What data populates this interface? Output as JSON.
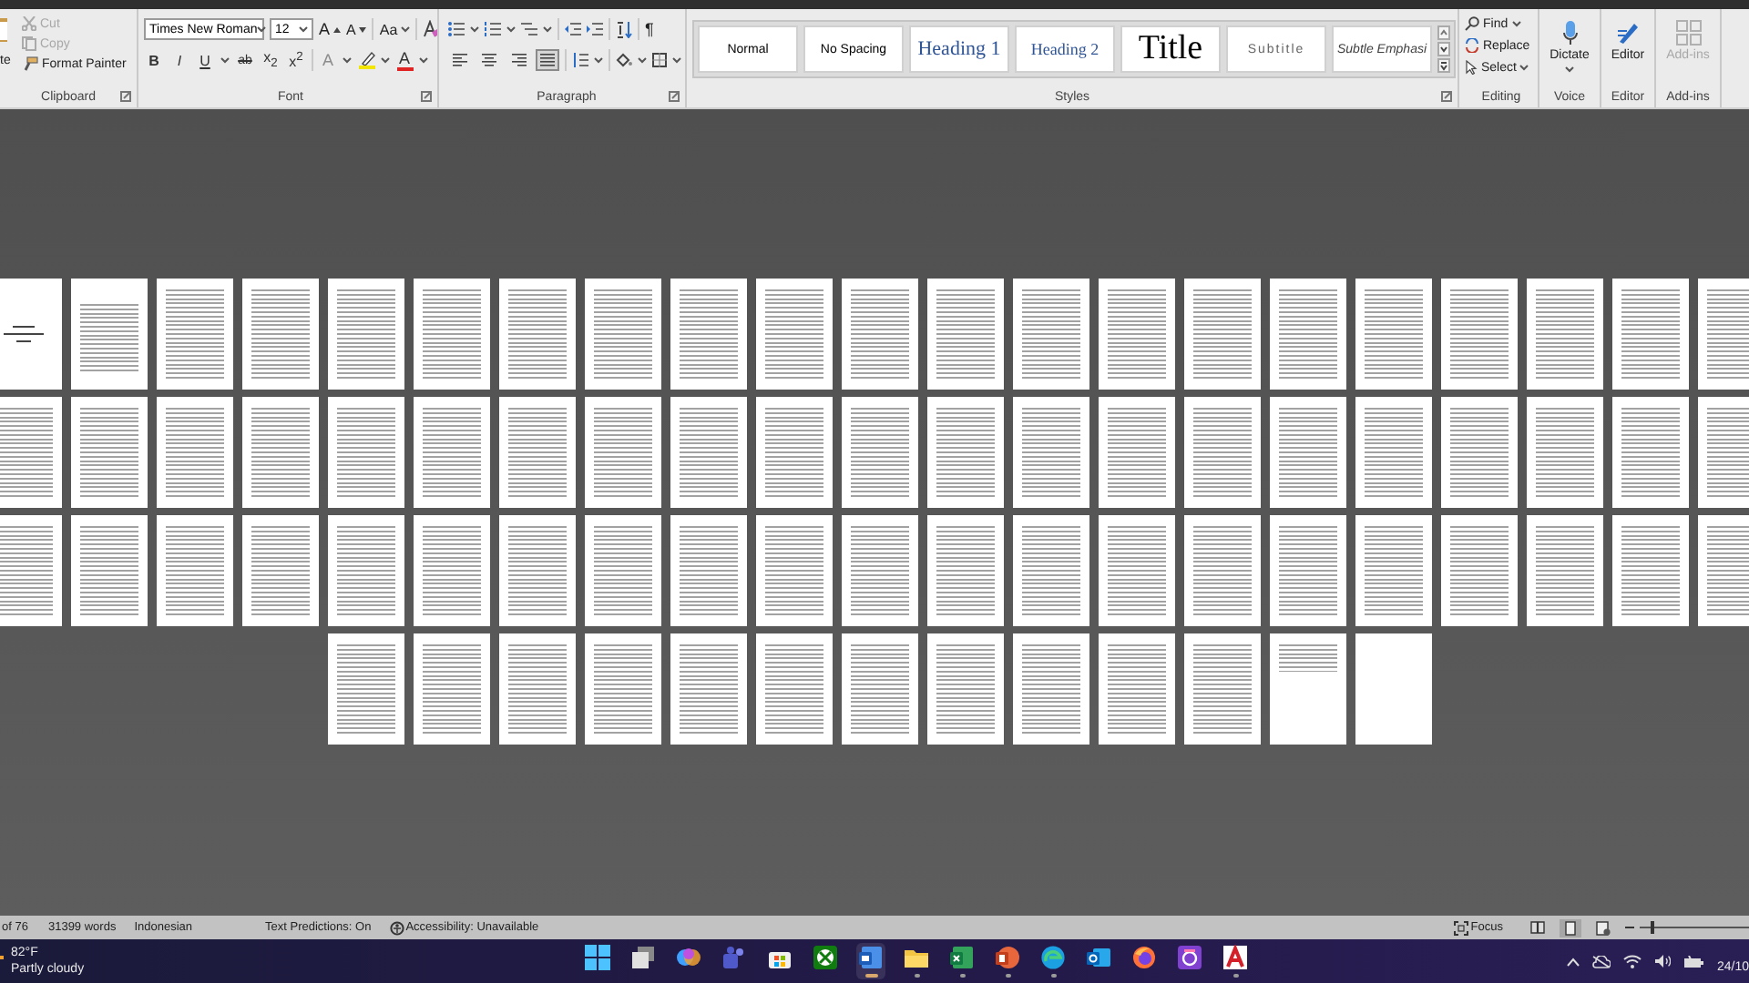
{
  "ribbon": {
    "clipboard": {
      "paste_label": "te",
      "items": [
        {
          "kind": "cut",
          "label": "Cut",
          "disabled": true
        },
        {
          "kind": "copy",
          "label": "Copy",
          "disabled": true
        },
        {
          "kind": "painter",
          "label": "Format Painter",
          "disabled": false
        }
      ],
      "group_label": "Clipboard"
    },
    "font": {
      "font_name": "Times New Roman",
      "font_size": "12",
      "grow_font": "A",
      "shrink_font": "A",
      "case_button": "Aa",
      "format_buttons": [
        "B",
        "I",
        "U",
        "ab",
        "x$_{2}$",
        "x$^{2}$"
      ],
      "color_buttons": [
        {
          "kind": "text_effects",
          "glyph": "A",
          "color": "#8c8c8c"
        },
        {
          "kind": "highlight",
          "color": "#f2e600"
        },
        {
          "kind": "font_color",
          "glyph": "A",
          "color": "#e02424"
        }
      ],
      "group_label": "Font"
    },
    "paragraph": {
      "show_marks": "¶",
      "alignments": [
        {
          "kind": "left",
          "selected": false
        },
        {
          "kind": "center",
          "selected": false
        },
        {
          "kind": "right",
          "selected": false
        },
        {
          "kind": "justify",
          "selected": true
        }
      ],
      "group_label": "Paragraph"
    },
    "styles": {
      "items": [
        {
          "kind": "normal",
          "label": "Normal"
        },
        {
          "kind": "no_spacing",
          "label": "No Spacing"
        },
        {
          "kind": "heading1",
          "label": "Heading 1"
        },
        {
          "kind": "heading2",
          "label": "Heading 2"
        },
        {
          "kind": "title",
          "label": "Title"
        },
        {
          "kind": "subtitle",
          "label": "Subtitle"
        },
        {
          "kind": "subtle_emphasis",
          "label": "Subtle Emphasi"
        }
      ],
      "group_label": "Styles"
    },
    "editing": {
      "items": [
        {
          "kind": "find",
          "label": "Find"
        },
        {
          "kind": "replace",
          "label": "Replace"
        },
        {
          "kind": "select",
          "label": "Select"
        }
      ],
      "group_label": "Editing"
    },
    "voice": {
      "button": "Dictate",
      "group_label": "Voice"
    },
    "editor": {
      "button": "Editor",
      "group_label": "Editor"
    },
    "addins": {
      "button": "Add-ins",
      "disabled": true,
      "group_label": "Add-ins"
    }
  },
  "pages": [
    {
      "kind": "cover"
    },
    {
      "kind": "front"
    },
    {
      "kind": "text"
    },
    {
      "kind": "text"
    },
    {
      "kind": "text"
    },
    {
      "kind": "text"
    },
    {
      "kind": "text"
    },
    {
      "kind": "text"
    },
    {
      "kind": "text"
    },
    {
      "kind": "text"
    },
    {
      "kind": "text"
    },
    {
      "kind": "text"
    },
    {
      "kind": "text"
    },
    {
      "kind": "text"
    },
    {
      "kind": "text"
    },
    {
      "kind": "text"
    },
    {
      "kind": "text"
    },
    {
      "kind": "text"
    },
    {
      "kind": "text"
    },
    {
      "kind": "text"
    },
    {
      "kind": "text"
    },
    {
      "kind": "text"
    },
    {
      "kind": "text"
    },
    {
      "kind": "text"
    },
    {
      "kind": "text"
    },
    {
      "kind": "text"
    },
    {
      "kind": "text"
    },
    {
      "kind": "text"
    },
    {
      "kind": "text"
    },
    {
      "kind": "text"
    },
    {
      "kind": "text"
    },
    {
      "kind": "text"
    },
    {
      "kind": "text"
    },
    {
      "kind": "text"
    },
    {
      "kind": "text"
    },
    {
      "kind": "text"
    },
    {
      "kind": "text"
    },
    {
      "kind": "text"
    },
    {
      "kind": "text"
    },
    {
      "kind": "text"
    },
    {
      "kind": "text"
    },
    {
      "kind": "text"
    },
    {
      "kind": "text"
    },
    {
      "kind": "text"
    },
    {
      "kind": "text"
    },
    {
      "kind": "text"
    },
    {
      "kind": "text"
    },
    {
      "kind": "text"
    },
    {
      "kind": "text"
    },
    {
      "kind": "text"
    },
    {
      "kind": "text"
    },
    {
      "kind": "text"
    },
    {
      "kind": "text"
    },
    {
      "kind": "text"
    },
    {
      "kind": "text"
    },
    {
      "kind": "text"
    },
    {
      "kind": "text"
    },
    {
      "kind": "text"
    },
    {
      "kind": "text"
    },
    {
      "kind": "text"
    },
    {
      "kind": "text"
    },
    {
      "kind": "text"
    },
    {
      "kind": "text"
    },
    {
      "kind": "text"
    },
    {
      "kind": "text"
    },
    {
      "kind": "text"
    },
    {
      "kind": "text"
    },
    {
      "kind": "text"
    },
    {
      "kind": "text"
    },
    {
      "kind": "text"
    },
    {
      "kind": "text"
    },
    {
      "kind": "text"
    },
    {
      "kind": "text"
    },
    {
      "kind": "text"
    },
    {
      "kind": "short"
    },
    {
      "kind": "blank"
    }
  ],
  "status_bar": {
    "page_count": "of 76",
    "word_count": "31399 words",
    "language": "Indonesian",
    "text_predictions": "Text Predictions: On",
    "accessibility": "Accessibility: Unavailable",
    "focus": "Focus",
    "views": [
      {
        "kind": "read",
        "selected": false
      },
      {
        "kind": "print",
        "selected": true
      },
      {
        "kind": "web",
        "selected": false
      }
    ],
    "zoom": {
      "level": 0.1
    }
  },
  "taskbar": {
    "weather": {
      "temperature": "82°F",
      "condition": "Partly cloudy"
    },
    "apps": [
      {
        "kind": "start",
        "running": false,
        "selected": false
      },
      {
        "kind": "task_view",
        "running": false,
        "selected": false
      },
      {
        "kind": "assistant",
        "running": false,
        "selected": false
      },
      {
        "kind": "chat",
        "running": false,
        "selected": false
      },
      {
        "kind": "store",
        "running": false,
        "selected": false
      },
      {
        "kind": "game",
        "running": false,
        "selected": false
      },
      {
        "kind": "word",
        "running": true,
        "selected": true
      },
      {
        "kind": "folder",
        "running": true,
        "selected": false
      },
      {
        "kind": "sheet",
        "running": true,
        "selected": false
      },
      {
        "kind": "slides",
        "running": true,
        "selected": false
      },
      {
        "kind": "browser",
        "running": true,
        "selected": false
      },
      {
        "kind": "mail",
        "running": false,
        "selected": false
      },
      {
        "kind": "fox",
        "running": false,
        "selected": false
      },
      {
        "kind": "camera",
        "running": false,
        "selected": false
      },
      {
        "kind": "pdf",
        "running": true,
        "selected": false
      }
    ],
    "date": "24/10"
  }
}
